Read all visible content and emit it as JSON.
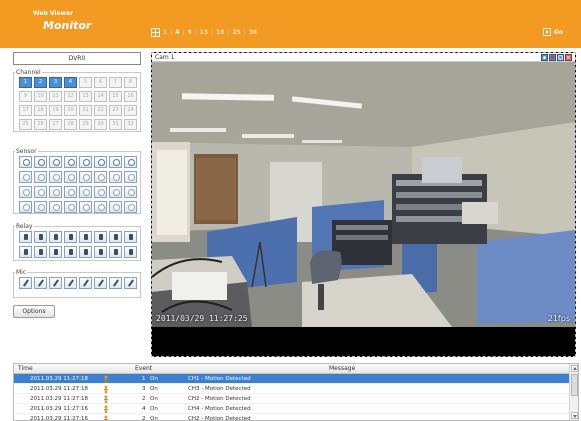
{
  "header": {
    "logo_line1": "Web Viewer",
    "logo_line2": "Monitor",
    "split_buttons": [
      "1",
      "4",
      "9",
      "13",
      "16",
      "25",
      "36"
    ],
    "split_active": "4",
    "go_label": "Go",
    "bg_color": "#f39a22"
  },
  "left": {
    "dvr_label": "DVR0",
    "channel_legend": "Channel",
    "channels": [
      "1",
      "2",
      "3",
      "4",
      "5",
      "6",
      "7",
      "8",
      "9",
      "10",
      "11",
      "12",
      "13",
      "14",
      "15",
      "16",
      "17",
      "18",
      "19",
      "20",
      "21",
      "22",
      "23",
      "24",
      "25",
      "26",
      "27",
      "28",
      "29",
      "30",
      "31",
      "32"
    ],
    "active_channels": [
      "1",
      "2",
      "3",
      "4"
    ],
    "sensor_legend": "Sensor",
    "relay_legend": "Relay",
    "mic_legend": "Mic",
    "options_label": "Options"
  },
  "video": {
    "cam_label": "Cam 1",
    "osd_timestamp": "2011/03/29 11:27:25",
    "osd_fps": "21fps"
  },
  "log": {
    "columns": {
      "time": "Time",
      "event": "Event",
      "message": "Message"
    },
    "rows": [
      {
        "time": "2011.03.29 11:27:18",
        "channel": "1",
        "state": "On",
        "message": "CH1 - Motion Detected",
        "selected": true
      },
      {
        "time": "2011.03.29 11:27:18",
        "channel": "3",
        "state": "On",
        "message": "CH3 - Motion Detected",
        "selected": false
      },
      {
        "time": "2011.03.29 11:27:18",
        "channel": "2",
        "state": "On",
        "message": "CH2 - Motion Detected",
        "selected": false
      },
      {
        "time": "2011.03.29 11:27:16",
        "channel": "4",
        "state": "On",
        "message": "CH4 - Motion Detected",
        "selected": false
      },
      {
        "time": "2011.03.29 11:27:16",
        "channel": "2",
        "state": "On",
        "message": "CH2 - Motion Detected",
        "selected": false
      }
    ],
    "selection_color": "#3a7fd0"
  }
}
